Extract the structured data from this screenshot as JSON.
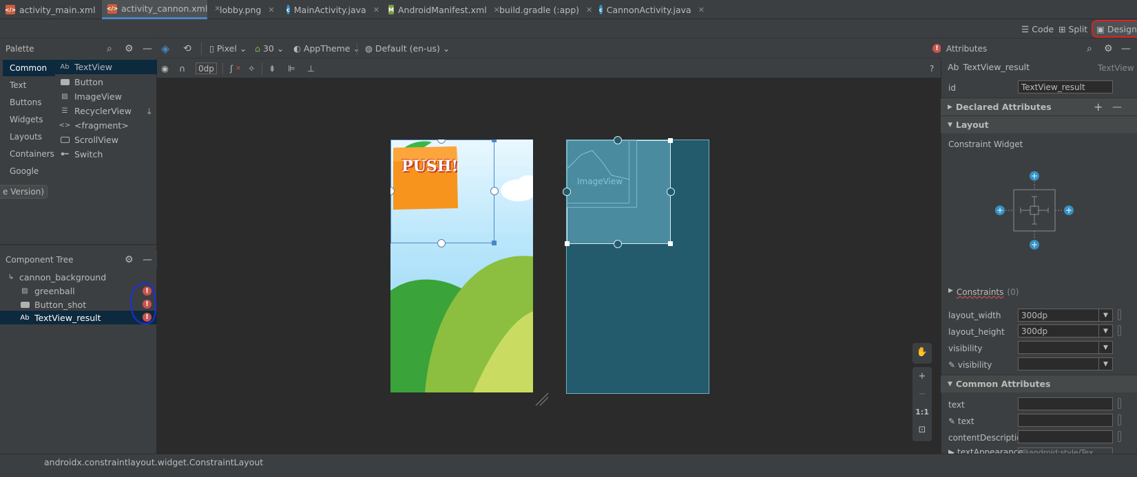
{
  "tabs": [
    {
      "label": "activity_main.xml",
      "icon": "xml-file-icon",
      "active": false
    },
    {
      "label": "activity_cannon.xml",
      "icon": "xml-file-icon",
      "active": true
    },
    {
      "label": "lobby.png",
      "icon": "image-file-icon",
      "active": false
    },
    {
      "label": "MainActivity.java",
      "icon": "java-class-icon",
      "active": false
    },
    {
      "label": "AndroidManifest.xml",
      "icon": "manifest-file-icon",
      "active": false
    },
    {
      "label": "build.gradle (:app)",
      "icon": "gradle-icon",
      "active": false
    },
    {
      "label": "CannonActivity.java",
      "icon": "java-class-icon",
      "active": false
    }
  ],
  "view_modes": {
    "code": "Code",
    "split": "Split",
    "design": "Design"
  },
  "palette": {
    "title": "Palette",
    "categories": [
      "Common",
      "Text",
      "Buttons",
      "Widgets",
      "Layouts",
      "Containers",
      "Google"
    ],
    "items": [
      {
        "label": "TextView",
        "icon": "Ab"
      },
      {
        "label": "Button",
        "icon": "button-icon"
      },
      {
        "label": "ImageView",
        "icon": "image-icon"
      },
      {
        "label": "RecyclerView",
        "icon": "list-icon"
      },
      {
        "label": "<fragment>",
        "icon": "code-icon"
      },
      {
        "label": "ScrollView",
        "icon": "scroll-icon"
      },
      {
        "label": "Switch",
        "icon": "switch-icon"
      }
    ],
    "clipped_text": "e Version)"
  },
  "component_tree": {
    "title": "Component Tree",
    "root": "cannon_background",
    "children": [
      {
        "label": "greenball",
        "icon": "image-icon"
      },
      {
        "label": "Button_shot",
        "icon": "button-icon"
      },
      {
        "label": "TextView_result",
        "icon": "Ab"
      }
    ]
  },
  "toolbar": {
    "device": "Pixel",
    "api": "30",
    "theme": "AppTheme",
    "locale": "Default (en-us)",
    "margin": "0dp"
  },
  "design": {
    "push_text": "PUSH!",
    "blueprint_label": "ImageView"
  },
  "attributes": {
    "title": "Attributes",
    "component_name": "TextView_result",
    "component_type": "TextView",
    "component_icon": "Ab",
    "id_label": "id",
    "id_value": "TextView_result",
    "sections": {
      "declared": "Declared Attributes",
      "layout": "Layout",
      "common": "Common Attributes"
    },
    "constraint_widget_label": "Constraint Widget",
    "constraints_label": "Constraints",
    "constraints_count": "(0)",
    "layout_width_label": "layout_width",
    "layout_width": "300dp",
    "layout_height_label": "layout_height",
    "layout_height": "300dp",
    "visibility_label": "visibility",
    "tools_visibility_label": "visibility",
    "text_label": "text",
    "tools_text_label": "text",
    "content_description_label": "contentDescription",
    "text_appearance_label": "textAppearance",
    "text_appearance_value": "@android:style/Tex"
  },
  "zoom": {
    "one_to_one": "1:1"
  },
  "status": {
    "path": "androidx.constraintlayout.widget.ConstraintLayout"
  },
  "colors": {
    "accent": "#4a88c7",
    "error": "#c75450",
    "selection": "#0d293e",
    "blueprint": "#235a6c"
  }
}
